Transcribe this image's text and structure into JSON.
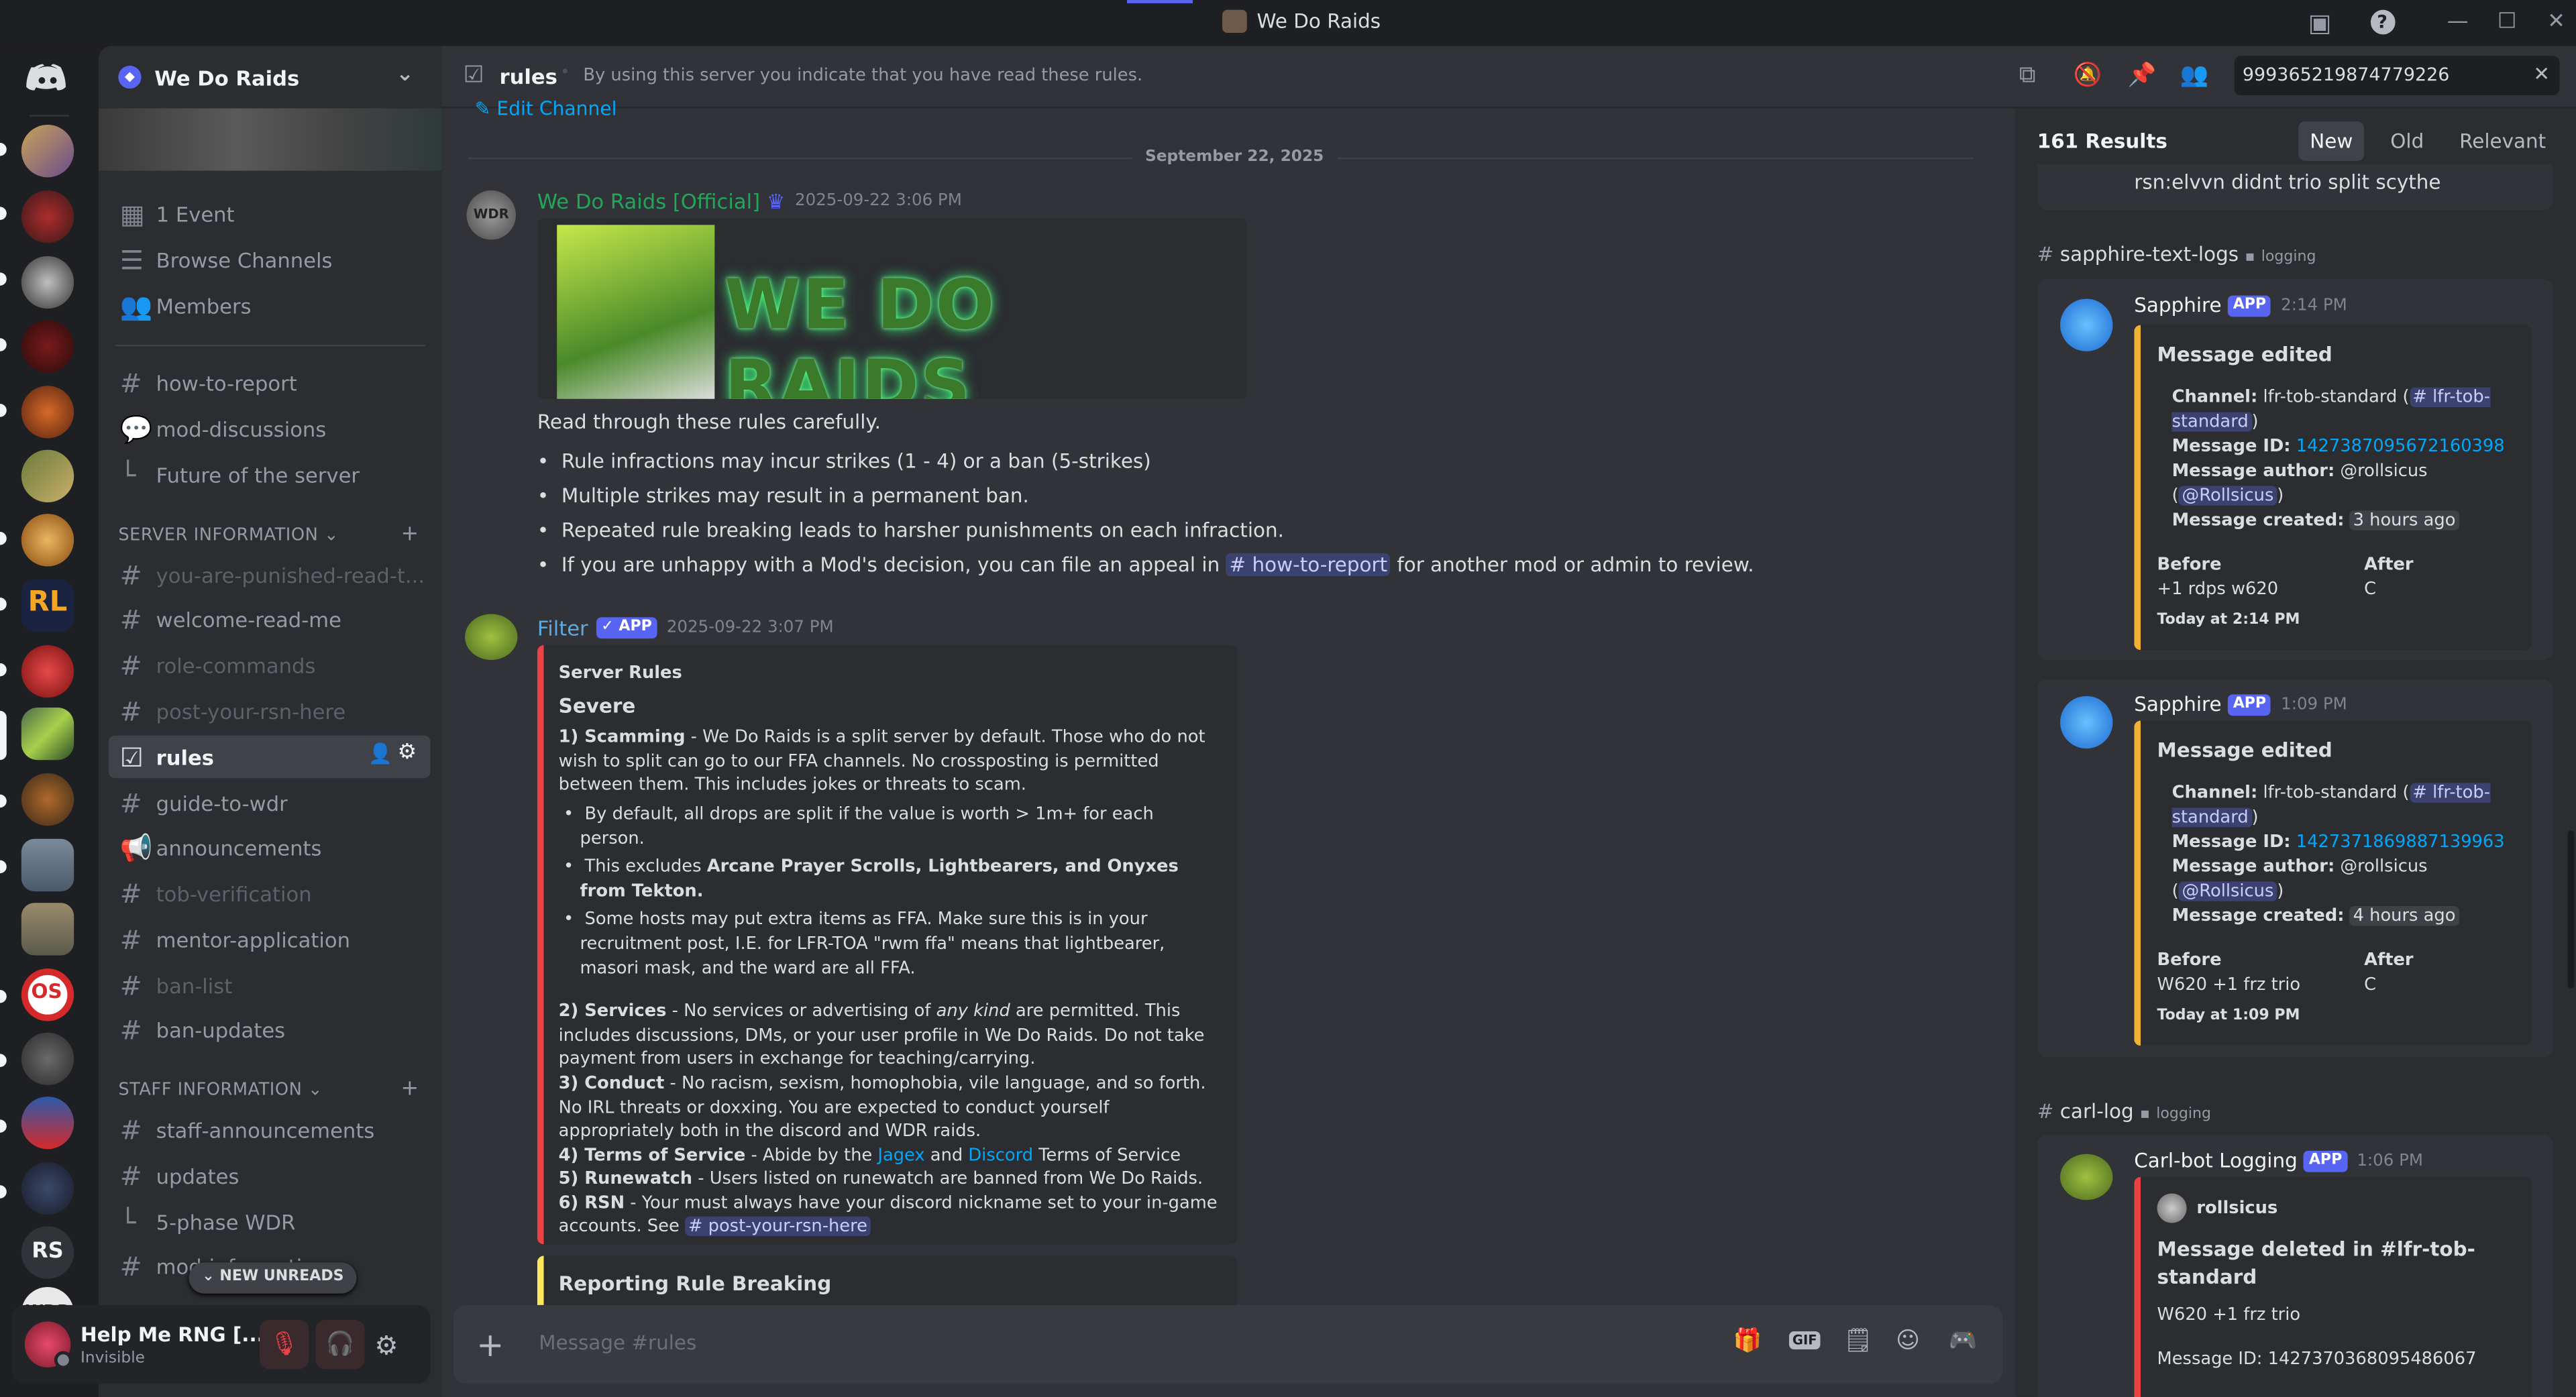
{
  "window": {
    "title": "We Do Raids"
  },
  "server": {
    "name": "We Do Raids"
  },
  "sidebar": {
    "top": [
      {
        "label": "1 Event"
      },
      {
        "label": "Browse Channels"
      },
      {
        "label": "Members"
      }
    ],
    "channels": [
      {
        "label": "how-to-report"
      },
      {
        "label": "mod-discussions"
      },
      {
        "label": "Future of the server"
      }
    ],
    "server_info_label": "SERVER INFORMATION",
    "server_info": [
      {
        "label": "you-are-punished-read-t..."
      },
      {
        "label": "welcome-read-me"
      },
      {
        "label": "role-commands"
      },
      {
        "label": "post-your-rsn-here"
      },
      {
        "label": "rules"
      },
      {
        "label": "guide-to-wdr"
      },
      {
        "label": "announcements"
      },
      {
        "label": "tob-verification"
      },
      {
        "label": "mentor-application"
      },
      {
        "label": "ban-list"
      },
      {
        "label": "ban-updates"
      }
    ],
    "staff_info_label": "STAFF INFORMATION",
    "staff_info": [
      {
        "label": "staff-announcements"
      },
      {
        "label": "updates"
      },
      {
        "label": "5-phase WDR"
      },
      {
        "label": "mod-information"
      }
    ],
    "new_unreads": "NEW UNREADS",
    "rs_label": "RS",
    "wdr_label": "WDR"
  },
  "user": {
    "name": "Help Me RNG [...",
    "status": "Invisible"
  },
  "header": {
    "channel": "rules",
    "topic": "By using this server you indicate that you have read these rules.",
    "search": "999365219874779226"
  },
  "chat": {
    "edit_channel": "Edit Channel",
    "date_divider": "September 22, 2025",
    "msg1": {
      "author": "We Do Raids [Official]",
      "time": "2025-09-22 3:06 PM",
      "banner_text": "WE DO RAIDS",
      "intro": "Read through these rules carefully.",
      "bullets": [
        "Rule infractions may incur strikes (1 - 4) or a ban (5-strikes)",
        "Multiple strikes may result in a permanent ban.",
        "Repeated rule breaking leads to harsher punishments on each infraction."
      ],
      "bullet4_pre": "If you are unhappy with a Mod's decision, you can file an appeal in",
      "bullet4_mention": "# how-to-report",
      "bullet4_post": "for another mod or admin to review."
    },
    "msg2": {
      "author": "Filter",
      "badge": "✓ APP",
      "time": "2025-09-22 3:07 PM",
      "embed_title": "Server Rules",
      "section": "Severe",
      "r1_head": "1) Scamming",
      "r1_text": " - We Do Raids is a split server by default. Those who do not wish to split can go to our FFA channels. No crossposting is permitted between them. This includes jokes or threats to scam.",
      "r1_b1": "By default, all drops are split if the value is worth > 1m+ for each person.",
      "r1_b2_pre": "This excludes ",
      "r1_b2_bold": "Arcane Prayer Scrolls, Lightbearers, and Onyxes from Tekton.",
      "r1_b3": "Some hosts may put extra items as FFA. Make sure this is in your recruitment post, I.E. for LFR-TOA \"rwm ffa\" means that lightbearer, masori mask, and the ward are all FFA.",
      "r2_head": "2) Services",
      "r2_a": " - No services or advertising of ",
      "r2_em": "any kind",
      "r2_b": " are permitted. This includes discussions, DMs, or your user profile in We Do Raids. Do not take payment from users in exchange for teaching/carrying.",
      "r3_head": "3) Conduct",
      "r3_text": " - No racism, sexism, homophobia, vile language, and so forth. No IRL threats or doxxing. You are expected to conduct yourself appropriately both in the discord and WDR raids.",
      "r4_head": "4) Terms of Service",
      "r4_a": " - Abide by the ",
      "r4_l1": "Jagex",
      "r4_and": " and ",
      "r4_l2": "Discord",
      "r4_b": " Terms of Service",
      "r5_head": "5) Runewatch",
      "r5_text": " - Users listed on runewatch are banned from We Do Raids.",
      "r6_head": "6) RSN",
      "r6_text": " - Your must always have your discord nickname set to your in-game accounts. See ",
      "r6_mention": "# post-your-rsn-here",
      "embed2_title": "Reporting Rule Breaking"
    },
    "composer_placeholder": "Message #rules"
  },
  "results": {
    "count": "161 Results",
    "tabs": [
      "New",
      "Old",
      "Relevant"
    ],
    "prev_text": "rsn:elvvn didnt trio split scythe",
    "group1": {
      "channel": "sapphire-text-logs",
      "category": "logging"
    },
    "card1": {
      "author": "Sapphire",
      "badge": "APP",
      "time": "2:14 PM",
      "title": "Message edited",
      "channel_k": "Channel:",
      "channel_v": " lfr-tob-standard (",
      "channel_m": "# lfr-tob-standard",
      "channel_close": ")",
      "msgid_k": "Message ID:",
      "msgid_v": "1427387095672160398",
      "author_k": "Message author:",
      "author_v": " @rollsicus",
      "author_m": "@Rollsicus",
      "created_k": "Message created:",
      "created_v": "3 hours ago",
      "before_k": "Before",
      "before_v": "+1 rdps w620",
      "after_k": "After",
      "after_v": "C",
      "footer": "Today at 2:14 PM"
    },
    "card2": {
      "author": "Sapphire",
      "badge": "APP",
      "time": "1:09 PM",
      "title": "Message edited",
      "channel_k": "Channel:",
      "channel_v": " lfr-tob-standard (",
      "channel_m": "# lfr-tob-standard",
      "channel_close": ")",
      "msgid_k": "Message ID:",
      "msgid_v": "1427371869887139963",
      "author_k": "Message author:",
      "author_v": " @rollsicus",
      "author_m": "@Rollsicus",
      "created_k": "Message created:",
      "created_v": "4 hours ago",
      "before_k": "Before",
      "before_v": "W620 +1 frz trio",
      "after_k": "After",
      "after_v": "C",
      "footer": "Today at 1:09 PM"
    },
    "group2": {
      "channel": "carl-log",
      "category": "logging"
    },
    "card3": {
      "author": "Carl-bot Logging",
      "badge": "APP",
      "time": "1:06 PM",
      "user": "rollsicus",
      "title": "Message deleted in #lfr-tob-standard",
      "content": "W620 +1 frz trio",
      "msgid": "Message ID: 1427370368095486067"
    }
  },
  "colors": {
    "accent": "#5865f2",
    "danger": "#ed4245",
    "warn": "#f0b232",
    "green": "#23a55a",
    "link": "#00a8fc"
  }
}
